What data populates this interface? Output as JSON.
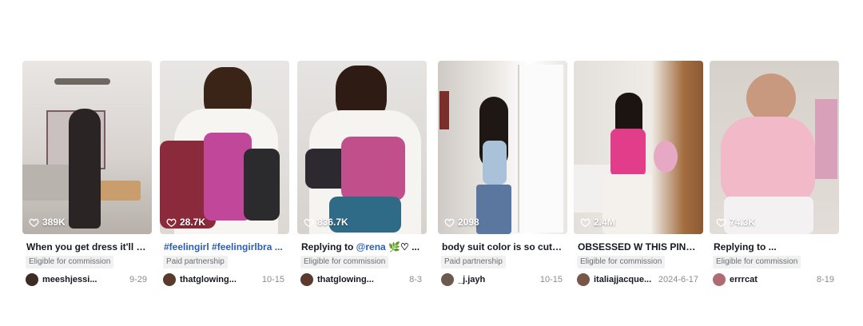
{
  "cards": [
    {
      "likes": "389K",
      "caption": "When you get dress it'll give...",
      "badge": "Eligible for commission",
      "user": "meeshjessi...",
      "date": "9-29"
    },
    {
      "likes": "28.7K",
      "caption_tag": "#feelingirl #feelingirlbra ...",
      "badge": "Paid partnership",
      "user": "thatglowing...",
      "date": "10-15"
    },
    {
      "likes": "836.7K",
      "caption_prefix": "Replying to ",
      "caption_mention": "@rena",
      "caption_suffix": " 🌿♡ ...",
      "badge": "Eligible for commission",
      "user": "thatglowing...",
      "date": "8-3"
    },
    {
      "likes": "2098",
      "caption": "body suit color is so cute an...",
      "badge": "Paid partnership",
      "user": "_j.jayh",
      "date": "10-15"
    },
    {
      "likes": "2.4M",
      "caption": "OBSESSED W THIS PINK FO...",
      "badge": "Eligible for commission",
      "user": "italiajjacque...",
      "date": "2024-6-17"
    },
    {
      "likes": "74.3K",
      "caption": "Replying to ...",
      "badge": "Eligible for commission",
      "user": "errrcat",
      "date": "8-19"
    }
  ],
  "icons": {
    "like": "heart-outline-icon"
  },
  "colors": {
    "mention": "#2b5db9",
    "badge_bg": "#f1f1f2"
  }
}
